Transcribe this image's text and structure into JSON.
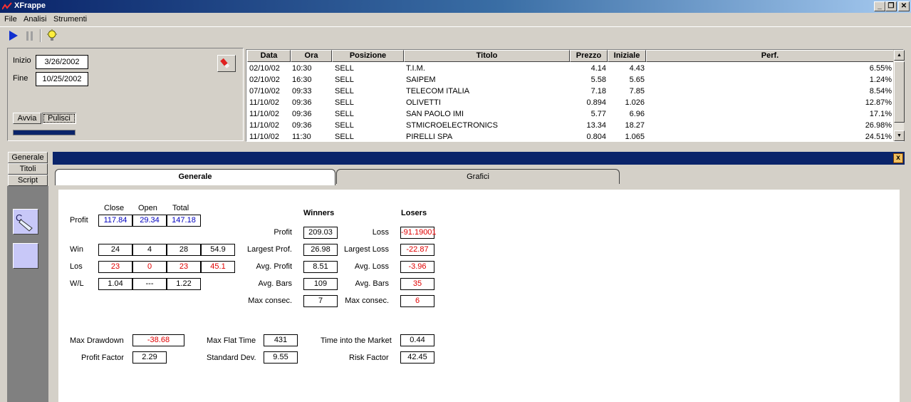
{
  "window": {
    "title": "XFrappe"
  },
  "menu": [
    "File",
    "Analisi",
    "Strumenti"
  ],
  "toolbar": {
    "icons": [
      "play-icon",
      "pause-icon",
      "lightbulb-icon"
    ]
  },
  "date_panel": {
    "inizio_label": "Inizio",
    "inizio_value": "3/26/2002",
    "fine_label": "Fine",
    "fine_value": "10/25/2002",
    "avvia_label": "Avvia",
    "pulisci_label": "Pulisci"
  },
  "trades": {
    "columns": [
      "Data",
      "Ora",
      "Posizione",
      "Titolo",
      "Prezzo",
      "Iniziale",
      "Perf."
    ],
    "rows": [
      [
        "02/10/02",
        "10:30",
        "SELL",
        "T.I.M.",
        "4.14",
        "4.43",
        "6.55%"
      ],
      [
        "02/10/02",
        "16:30",
        "SELL",
        "SAIPEM",
        "5.58",
        "5.65",
        "1.24%"
      ],
      [
        "07/10/02",
        "09:33",
        "SELL",
        "TELECOM ITALIA",
        "7.18",
        "7.85",
        "8.54%"
      ],
      [
        "11/10/02",
        "09:36",
        "SELL",
        "OLIVETTI",
        "0.894",
        "1.026",
        "12.87%"
      ],
      [
        "11/10/02",
        "09:36",
        "SELL",
        "SAN PAOLO IMI",
        "5.77",
        "6.96",
        "17.1%"
      ],
      [
        "11/10/02",
        "09:36",
        "SELL",
        "STMICROELECTRONICS",
        "13.34",
        "18.27",
        "26.98%"
      ],
      [
        "11/10/02",
        "11:30",
        "SELL",
        "PIRELLI SPA",
        "0.804",
        "1.065",
        "24.51%"
      ]
    ]
  },
  "side_tabs": [
    "Generale",
    "Titoli",
    "Script"
  ],
  "panel_tabs": [
    "Generale",
    "Grafici"
  ],
  "close_label": "x",
  "stats": {
    "headers": [
      "Close",
      "Open",
      "Total"
    ],
    "profit_label": "Profit",
    "profit": [
      "117.84",
      "29.34",
      "147.18"
    ],
    "win_label": "Win",
    "win": [
      "24",
      "4",
      "28",
      "54.9"
    ],
    "los_label": "Los",
    "los": [
      "23",
      "0",
      "23",
      "45.1"
    ],
    "wl_label": "W/L",
    "wl": [
      "1.04",
      "---",
      "1.22"
    ]
  },
  "winners": {
    "title": "Winners",
    "labels": [
      "Profit",
      "Largest Prof.",
      "Avg. Profit",
      "Avg. Bars",
      "Max consec."
    ],
    "values": [
      "209.03",
      "26.98",
      "8.51",
      "109",
      "7"
    ]
  },
  "losers": {
    "title": "Losers",
    "labels": [
      "Loss",
      "Largest Loss",
      "Avg. Loss",
      "Avg. Bars",
      "Max consec."
    ],
    "values": [
      "-91.19001",
      "-22.87",
      "-3.96",
      "35",
      "6"
    ]
  },
  "summary": {
    "max_drawdown_label": "Max Drawdown",
    "max_drawdown": "-38.68",
    "profit_factor_label": "Profit Factor",
    "profit_factor": "2.29",
    "max_flat_time_label": "Max Flat Time",
    "max_flat_time": "431",
    "std_dev_label": "Standard Dev.",
    "std_dev": "9.55",
    "time_market_label": "Time into the Market",
    "time_market": "0.44",
    "risk_factor_label": "Risk Factor",
    "risk_factor": "42.45"
  },
  "colors": {
    "title_start": "#0a246a",
    "negative": "#e00000",
    "positive_open": "#0000c0"
  }
}
